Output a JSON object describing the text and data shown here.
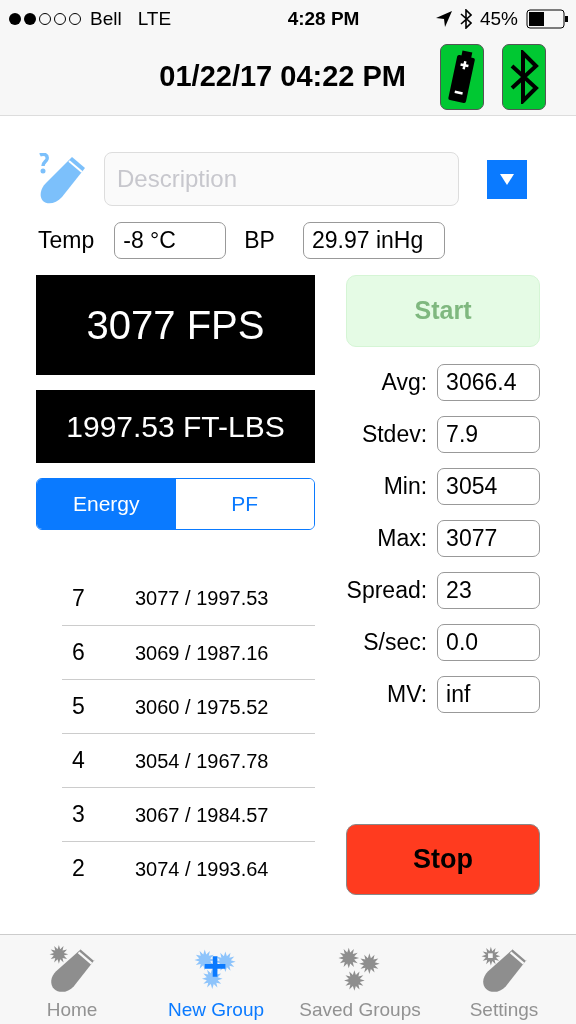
{
  "status_bar": {
    "carrier": "Bell",
    "network": "LTE",
    "time": "4:28 PM",
    "battery": "45%"
  },
  "header": {
    "datetime": "01/22/17 04:22 PM",
    "battery_on": true,
    "bluetooth_on": true
  },
  "description": {
    "placeholder": "Description"
  },
  "conditions": [
    {
      "label": "Temp",
      "value": "-8 °C"
    },
    {
      "label": "BP",
      "value": "29.97 inHg"
    }
  ],
  "velocity": "3077 FPS",
  "energy": "1997.53 FT-LBS",
  "segments": [
    {
      "label": "Energy",
      "selected": true
    },
    {
      "label": "PF",
      "selected": false
    }
  ],
  "shots": [
    {
      "number": "7",
      "value": "3077 / 1997.53"
    },
    {
      "number": "6",
      "value": "3069 / 1987.16"
    },
    {
      "number": "5",
      "value": "3060 / 1975.52"
    },
    {
      "number": "4",
      "value": "3054 / 1967.78"
    },
    {
      "number": "3",
      "value": "3067 / 1984.57"
    },
    {
      "number": "2",
      "value": "3074 / 1993.64"
    }
  ],
  "start": {
    "label": "Start",
    "disabled": true
  },
  "stats": [
    {
      "label": "Avg:",
      "value": "3066.4"
    },
    {
      "label": "Stdev:",
      "value": "7.9"
    },
    {
      "label": "Min:",
      "value": "3054"
    },
    {
      "label": "Max:",
      "value": "3077"
    },
    {
      "label": "Spread:",
      "value": "23"
    },
    {
      "label": "S/sec:",
      "value": "0.0"
    },
    {
      "label": "MV:",
      "value": "inf"
    }
  ],
  "stop": {
    "label": "Stop"
  },
  "tabs": [
    {
      "label": "Home",
      "kind": "home",
      "selected": false
    },
    {
      "label": "New Group",
      "kind": "new",
      "selected": true
    },
    {
      "label": "Saved Groups",
      "kind": "saved",
      "selected": false
    },
    {
      "label": "Settings",
      "kind": "settings",
      "selected": false
    }
  ]
}
